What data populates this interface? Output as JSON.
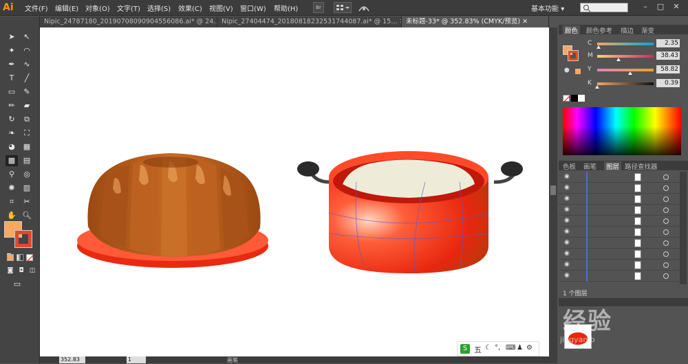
{
  "app": {
    "logo": "Ai",
    "workspace": "基本功能",
    "workspace_arrow": "▾"
  },
  "menu": [
    "文件(F)",
    "编辑(E)",
    "对象(O)",
    "文字(T)",
    "选择(S)",
    "效果(C)",
    "视图(V)",
    "窗口(W)",
    "帮助(H)"
  ],
  "menubar_icons": {
    "br": "Br"
  },
  "window_controls": {
    "minimize": "–",
    "maximize": "□",
    "close": "✕"
  },
  "tabs": [
    {
      "label": "Nipic_24787180_20190708090904556086.ai* @ 24…",
      "close": "✕"
    },
    {
      "label": "Nipic_27404474_20180818232531744087.ai* @ 15…",
      "close": "✕"
    },
    {
      "label": "未标题-33* @ 352.83% (CMYK/预览)",
      "close": "✕"
    }
  ],
  "color_panel": {
    "tabs": [
      "颜色",
      "颜色参考",
      "描边",
      "渐变"
    ],
    "channels": [
      {
        "label": "C",
        "value": "2.35",
        "level": 0.024
      },
      {
        "label": "M",
        "value": "38.43",
        "level": 0.384
      },
      {
        "label": "Y",
        "value": "58.82",
        "level": 0.588
      },
      {
        "label": "K",
        "value": "0.39",
        "level": 0.004
      }
    ],
    "fill_color": "#f7a863",
    "stroke_color": "#e04a2a"
  },
  "layers_panel": {
    "tabs": [
      "色板",
      "画笔",
      "图层",
      "路径查找器"
    ],
    "rows": 10,
    "status": "1 个图层"
  },
  "statusbar": {
    "zoom": "352.83",
    "page": "1",
    "tool": "画笔"
  },
  "ime": {
    "label": "五"
  },
  "watermark": {
    "text": "经验",
    "prefix": "jingyan.b"
  }
}
